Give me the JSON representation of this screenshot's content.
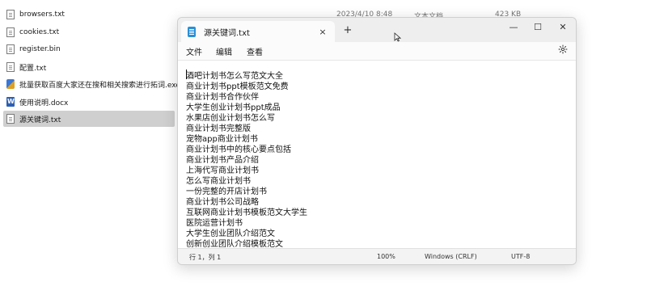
{
  "explorer": {
    "files": [
      {
        "name": "browsers.txt",
        "icon": "text-file-icon"
      },
      {
        "name": "cookies.txt",
        "icon": "text-file-icon"
      },
      {
        "name": "register.bin",
        "icon": "text-file-icon"
      },
      {
        "name": "配置.txt",
        "icon": "text-file-icon"
      },
      {
        "name": "批量获取百度大家还在搜和相关搜索进行拓词.exe",
        "icon": "exe-file-icon"
      },
      {
        "name": "使用说明.docx",
        "icon": "word-file-icon"
      },
      {
        "name": "源关键词.txt",
        "icon": "text-file-icon"
      }
    ],
    "first_row_meta": {
      "date": "2023/4/10 8:48",
      "type": "文本文档",
      "size": "423 KB"
    }
  },
  "notepad": {
    "tab_title": "源关键词.txt",
    "tab_close": "×",
    "new_tab": "+",
    "controls": {
      "minimize": "—",
      "maximize": "☐",
      "close": "✕"
    },
    "menu": [
      "文件",
      "编辑",
      "查看"
    ],
    "lines": [
      "酒吧计划书怎么写范文大全",
      "商业计划书ppt模板范文免费",
      "商业计划书合作伙伴",
      "大学生创业计划书ppt成品",
      "水果店创业计划书怎么写",
      "商业计划书完整版",
      "宠物app商业计划书",
      "商业计划书中的核心要点包括",
      "商业计划书产品介绍",
      "上海代写商业计划书",
      "怎么写商业计划书",
      "一份完整的开店计划书",
      "商业计划书公司战略",
      "互联网商业计划书模板范文大学生",
      "医院运营计划书",
      "大学生创业团队介绍范文",
      "创新创业团队介绍模板范文"
    ],
    "status": {
      "position": "行 1，列 1",
      "zoom": "100%",
      "line_ending": "Windows (CRLF)",
      "encoding": "UTF-8"
    }
  }
}
